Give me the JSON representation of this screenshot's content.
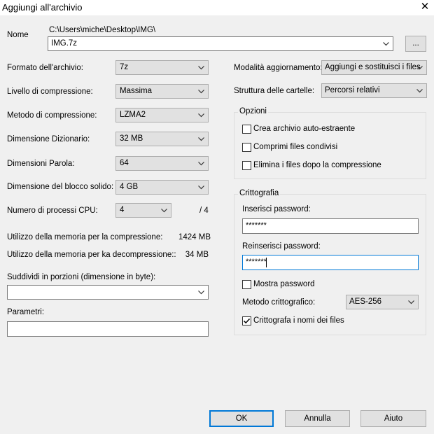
{
  "window": {
    "title": "Aggiungi all'archivio",
    "close_glyph": "✕"
  },
  "archive": {
    "name_label": "Nome",
    "path": "C:\\Users\\miche\\Desktop\\IMG\\",
    "filename": "IMG.7z",
    "browse_label": "..."
  },
  "left": {
    "format": {
      "label": "Formato dell'archivio:",
      "value": "7z"
    },
    "level": {
      "label": "Livello di compressione:",
      "value": "Massima"
    },
    "method": {
      "label": "Metodo di compressione:",
      "value": "LZMA2"
    },
    "dictionary": {
      "label": "Dimensione Dizionario:",
      "value": "32 MB"
    },
    "word": {
      "label": "Dimensioni Parola:",
      "value": "64"
    },
    "solid": {
      "label": "Dimensione del blocco solido:",
      "value": "4 GB"
    },
    "threads": {
      "label": "Numero di processi CPU:",
      "value": "4",
      "max": "/ 4"
    },
    "mem_compress": {
      "label": "Utilizzo della memoria per la compressione:",
      "value": "1424 MB"
    },
    "mem_decompress": {
      "label": "Utilizzo della memoria per ka decompressione::",
      "value": "34 MB"
    },
    "split": {
      "label": "Suddividi in porzioni (dimensione in byte):",
      "value": ""
    },
    "params": {
      "label": "Parametri:",
      "value": ""
    }
  },
  "right": {
    "update_mode": {
      "label": "Modalità aggiornamento:",
      "value": "Aggiungi e sostituisci i files"
    },
    "path_mode": {
      "label": "Struttura delle cartelle:",
      "value": "Percorsi relativi"
    },
    "options": {
      "title": "Opzioni",
      "sfx": {
        "label": "Crea archivio auto-estraente",
        "checked": false
      },
      "shared": {
        "label": "Comprimi files condivisi",
        "checked": false
      },
      "delete": {
        "label": "Elimina i files dopo la compressione",
        "checked": false
      }
    },
    "encryption": {
      "title": "Crittografia",
      "password_label": "Inserisci password:",
      "password_value": "*******",
      "reenter_label": "Reinserisci password:",
      "reenter_value": "*******",
      "show_password": {
        "label": "Mostra password",
        "checked": false
      },
      "method_label": "Metodo crittografico:",
      "method_value": "AES-256",
      "encrypt_names": {
        "label": "Crittografa i nomi dei files",
        "checked": true
      }
    }
  },
  "buttons": {
    "ok": "OK",
    "cancel": "Annulla",
    "help": "Aiuto"
  },
  "colors": {
    "accent": "#0078d7",
    "background": "#f0f0f0",
    "button_face": "#e1e1e1"
  }
}
